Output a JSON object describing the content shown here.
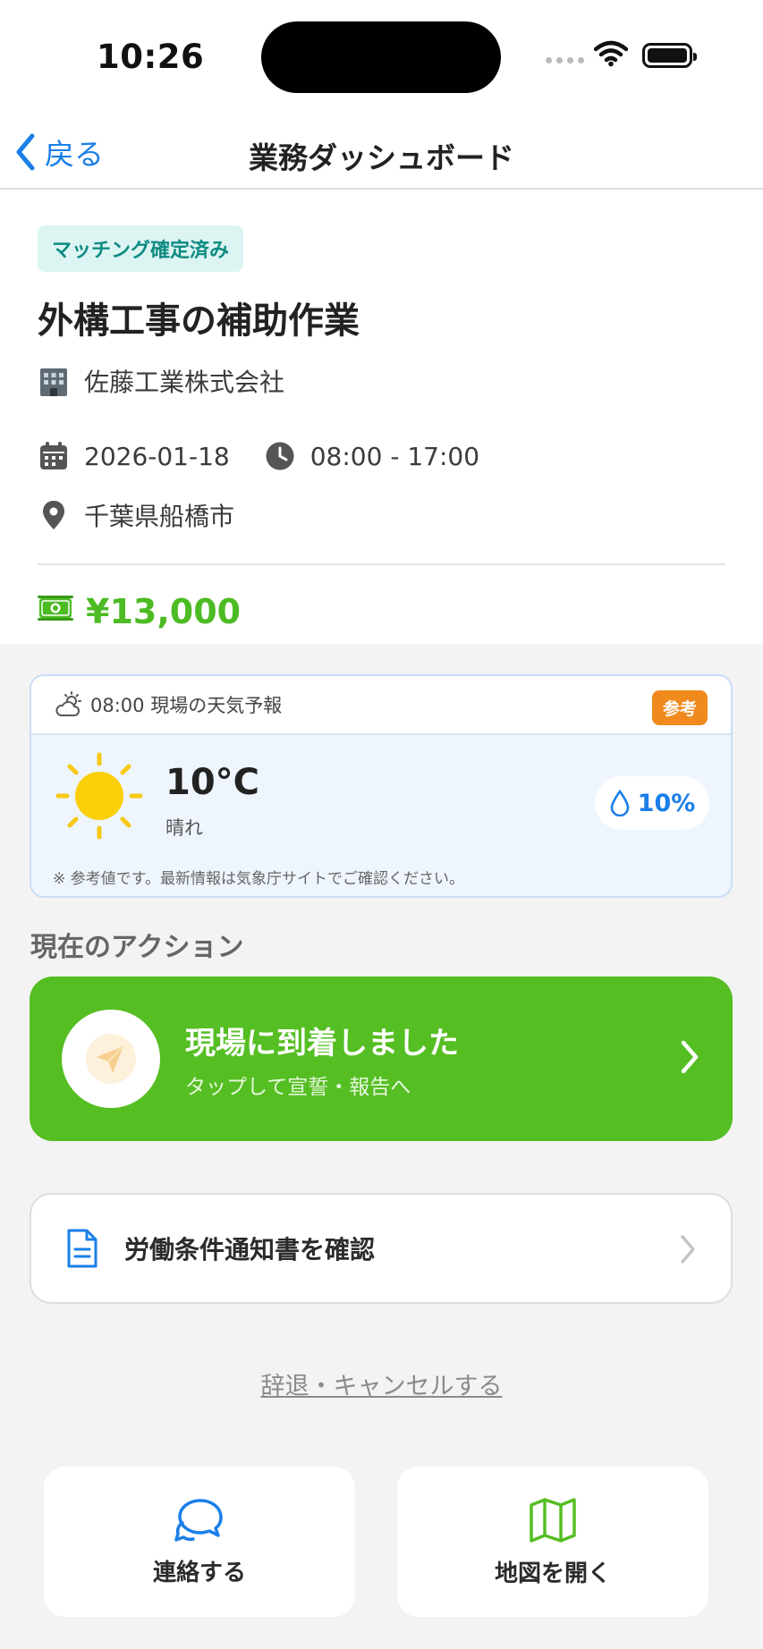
{
  "status_bar": {
    "time": "10:26"
  },
  "nav": {
    "back_label": "戻る",
    "title": "業務ダッシュボード"
  },
  "job": {
    "badge": "マッチング確定済み",
    "title": "外構工事の補助作業",
    "company": "佐藤工業株式会社",
    "date": "2026-01-18",
    "time_range": "08:00 - 17:00",
    "location": "千葉県船橋市",
    "pay": "¥13,000"
  },
  "weather": {
    "header": "08:00 現場の天気予報",
    "badge": "参考",
    "temperature": "10°C",
    "condition": "晴れ",
    "precipitation": "10%",
    "note": "※ 参考値です。最新情報は気象庁サイトでご確認ください。"
  },
  "section": {
    "label": "現在のアクション"
  },
  "action": {
    "title": "現場に到着しました",
    "subtitle": "タップして宣誓・報告へ"
  },
  "document": {
    "label": "労働条件通知書を確認"
  },
  "cancel": {
    "label": "辞退・キャンセルする"
  },
  "tiles": {
    "contact": "連絡する",
    "map": "地図を開く"
  },
  "colors": {
    "accent_blue": "#1a7fe8",
    "green": "#55be22",
    "pay_green": "#4cbb24",
    "badge_orange": "#f08a1c",
    "badge_teal": "#0f8b82"
  },
  "icons": [
    "chevron-left-icon",
    "building-icon",
    "calendar-icon",
    "clock-icon",
    "location-pin-icon",
    "money-icon",
    "cloud-sun-icon",
    "sun-icon",
    "droplet-icon",
    "paper-plane-icon",
    "chevron-right-icon",
    "document-icon",
    "chat-bubbles-icon",
    "map-icon"
  ]
}
